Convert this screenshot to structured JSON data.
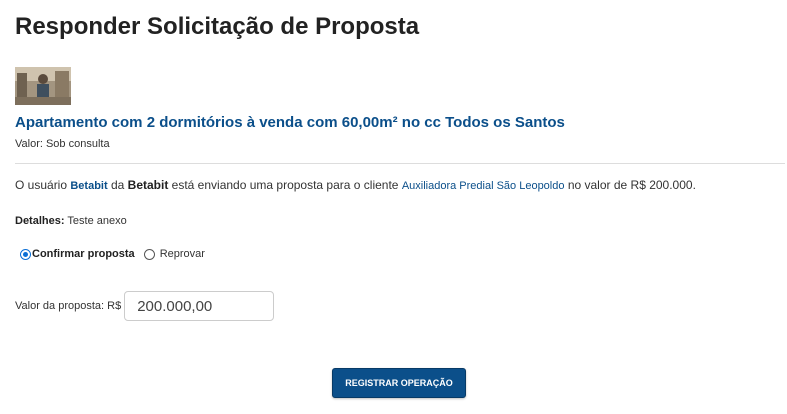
{
  "page": {
    "title": "Responder Solicitação de Proposta"
  },
  "listing": {
    "thumbnail_icon": "property-photo-thumbnail",
    "title": "Apartamento com 2 dormitórios à venda com 60,00m² no cc Todos os Santos",
    "price_label": "Valor: Sob consulta"
  },
  "message": {
    "prefix": "O usuário ",
    "user": "Betabit",
    "middle1": " da ",
    "company": "Betabit",
    "middle2": " está enviando uma proposta para o cliente ",
    "client": "Auxiliadora Predial São Leopoldo",
    "suffix": " no valor de R$ 200.000."
  },
  "details": {
    "label": "Detalhes:",
    "value": " Teste anexo"
  },
  "options": {
    "confirm_label": "Confirmar proposta",
    "reject_label": "Reprovar",
    "selected": "confirm"
  },
  "proposal_value": {
    "label": "Valor da proposta: R$",
    "value": "200.000,00"
  },
  "actions": {
    "submit_label": "REGISTRAR OPERAÇÃO"
  },
  "colors": {
    "link_blue": "#0b4f8a",
    "button_bg": "#0b4f8a",
    "radio_accent": "#0b6fd6"
  }
}
